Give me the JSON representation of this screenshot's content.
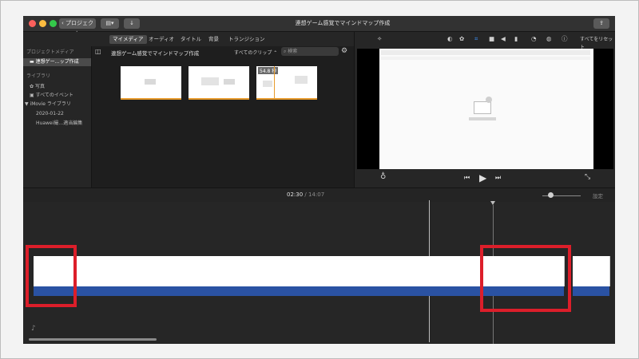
{
  "window": {
    "title": "連想ゲーム感覚でマインドマップ作成",
    "back_button": "プロジェクト"
  },
  "tabs": [
    "マイメディア",
    "オーディオ",
    "タイトル",
    "背景",
    "トランジション"
  ],
  "sidebar": {
    "project_media_header": "プロジェクトメディア",
    "project_item": "連想ゲー…ップ作成",
    "library_header": "ライブラリ",
    "items": [
      "写真",
      "すべてのイベント",
      "iMovie ライブラリ",
      "2020-01-22",
      "Huawei撮…適当編集"
    ]
  },
  "browser": {
    "title": "連想ゲーム感覚でマインドマップ作成",
    "filter": "すべてのクリップ",
    "search_placeholder": "検索",
    "clip_duration": "54.8 秒"
  },
  "viewer": {
    "reset_all": "すべてをリセット"
  },
  "timeline": {
    "current_time": "02:30",
    "total_time": "14:07",
    "settings": "設定"
  },
  "colors": {
    "accent": "#3a8cf0",
    "highlight": "#dc1e2a",
    "audio": "#2a52a3",
    "clip_underline": "#e79a2b"
  }
}
